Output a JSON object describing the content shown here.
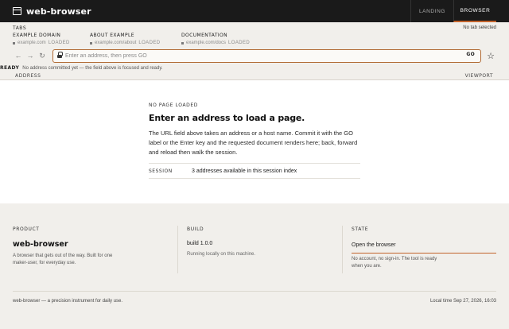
{
  "app": {
    "name": "web-browser",
    "nav": [
      {
        "label": "LANDING",
        "active": false
      },
      {
        "label": "BROWSER",
        "active": true
      }
    ]
  },
  "tabs": {
    "label": "TABS",
    "none_selected": "No tab selected",
    "items": [
      {
        "title": "EXAMPLE DOMAIN",
        "host": "example.com",
        "status": "LOADED"
      },
      {
        "title": "ABOUT EXAMPLE",
        "host": "example.com/about",
        "status": "LOADED"
      },
      {
        "title": "DOCUMENTATION",
        "host": "example.com/docs",
        "status": "LOADED"
      }
    ]
  },
  "address_bar": {
    "back_icon": "back-arrow-icon",
    "forward_icon": "forward-arrow-icon",
    "reload_icon": "reload-icon",
    "value": "",
    "placeholder": "Enter an address, then press GO",
    "go_label": "GO",
    "bookmark_icon": "star-icon"
  },
  "status": {
    "state": "READY",
    "message": "No address committed yet — the field above is focused and ready."
  },
  "columns": {
    "left": "ADDRESS",
    "right": "VIEWPORT"
  },
  "viewport": {
    "eyebrow": "NO PAGE LOADED",
    "title": "Enter an address to load a page.",
    "body": "The URL field above takes an address or a host name. Commit it with the GO label or the Enter key and the requested document renders here; back, forward and reload then walk the session.",
    "session_label": "SESSION",
    "session_value": "3 addresses available in this session index"
  },
  "footer": {
    "product": {
      "label": "PRODUCT",
      "name": "web-browser",
      "description": "A browser that gets out of the way. Built for one maker-user, for everyday use."
    },
    "build": {
      "label": "BUILD",
      "version": "build 1.0.0",
      "note": "Running locally on this machine."
    },
    "state": {
      "label": "STATE",
      "action": "Open the browser",
      "note": "No account, no sign-in. The tool is ready when you are."
    },
    "tagline": "web-browser — a precision instrument for daily use.",
    "local_time": "Local time Sep 27, 2026, 16:03"
  },
  "colors": {
    "accent": "#c2622a",
    "topbar": "#1a1a1a",
    "background": "#f1efeb",
    "viewport": "#ffffff"
  }
}
